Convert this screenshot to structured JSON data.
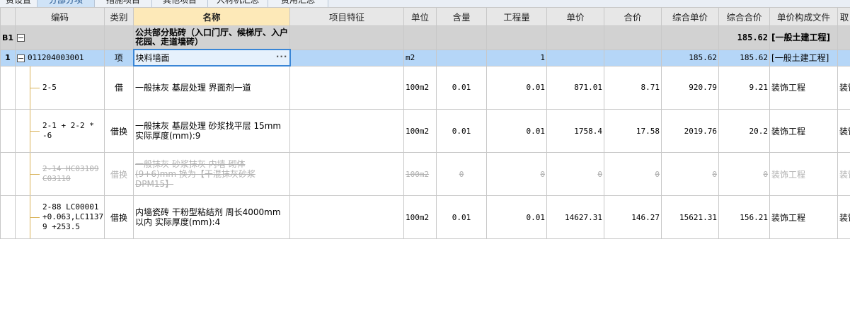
{
  "tabs": [
    {
      "label": "费设置",
      "active": false
    },
    {
      "label": "分部分项",
      "active": true
    },
    {
      "label": "措施项目",
      "active": false
    },
    {
      "label": "其他项目",
      "active": false
    },
    {
      "label": "人材机汇总",
      "active": false
    },
    {
      "label": "费用汇总",
      "active": false
    }
  ],
  "columns": [
    "",
    "编码",
    "类别",
    "名称",
    "项目特征",
    "单位",
    "含量",
    "工程量",
    "单价",
    "合价",
    "综合单价",
    "综合合价",
    "单价构成文件",
    "取"
  ],
  "section": {
    "rownum": "B1",
    "name": "公共部分贴砖（入口门厅、候梯厅、入户花园、走道墙砖）",
    "total": "185.62",
    "file": "[一般土建工程]"
  },
  "item": {
    "rownum": "1",
    "code": "011204003001",
    "type": "项",
    "name": "块料墙面",
    "dots": "···",
    "unit": "m2",
    "qty": "1",
    "unit_total": "185.62",
    "total": "185.62",
    "file": "[一般土建工程]"
  },
  "subs": [
    {
      "code": "2-5",
      "type": "借",
      "name": "一般抹灰 基层处理 界面剂一道",
      "unit": "100m2",
      "content": "0.01",
      "qty": "0.01",
      "price": "871.01",
      "amount": "8.71",
      "unit_total": "920.79",
      "total": "9.21",
      "file": "装饰工程",
      "extra": "装饰"
    },
    {
      "code": "2-1 + 2-2 * -6",
      "type": "借换",
      "name": "一般抹灰 基层处理 砂浆找平层 15mm 实际厚度(mm):9",
      "unit": "100m2",
      "content": "0.01",
      "qty": "0.01",
      "price": "1758.4",
      "amount": "17.58",
      "unit_total": "2019.76",
      "total": "20.2",
      "file": "装饰工程",
      "extra": "装饰"
    },
    {
      "code": "2-14 HC03109 C03110",
      "type": "借换",
      "name": "一般抹灰 砂浆抹灰 内墙 砌体 (9+6)mm 换为【干混抹灰砂浆 DPM15】",
      "unit": "100m2",
      "content": "0",
      "qty": "0",
      "price": "0",
      "amount": "0",
      "unit_total": "0",
      "total": "0",
      "file": "装饰工程",
      "extra": "装饰"
    },
    {
      "code": "2-88 LC00001 +0.063,LC1137 9 +253.5",
      "type": "借换",
      "name": "内墙瓷砖 干粉型粘结剂 周长4000mm以内 实际厚度(mm):4",
      "unit": "100m2",
      "content": "0.01",
      "qty": "0.01",
      "price": "14627.31",
      "amount": "146.27",
      "unit_total": "15621.31",
      "total": "156.21",
      "file": "装饰工程",
      "extra": "装饰"
    }
  ]
}
